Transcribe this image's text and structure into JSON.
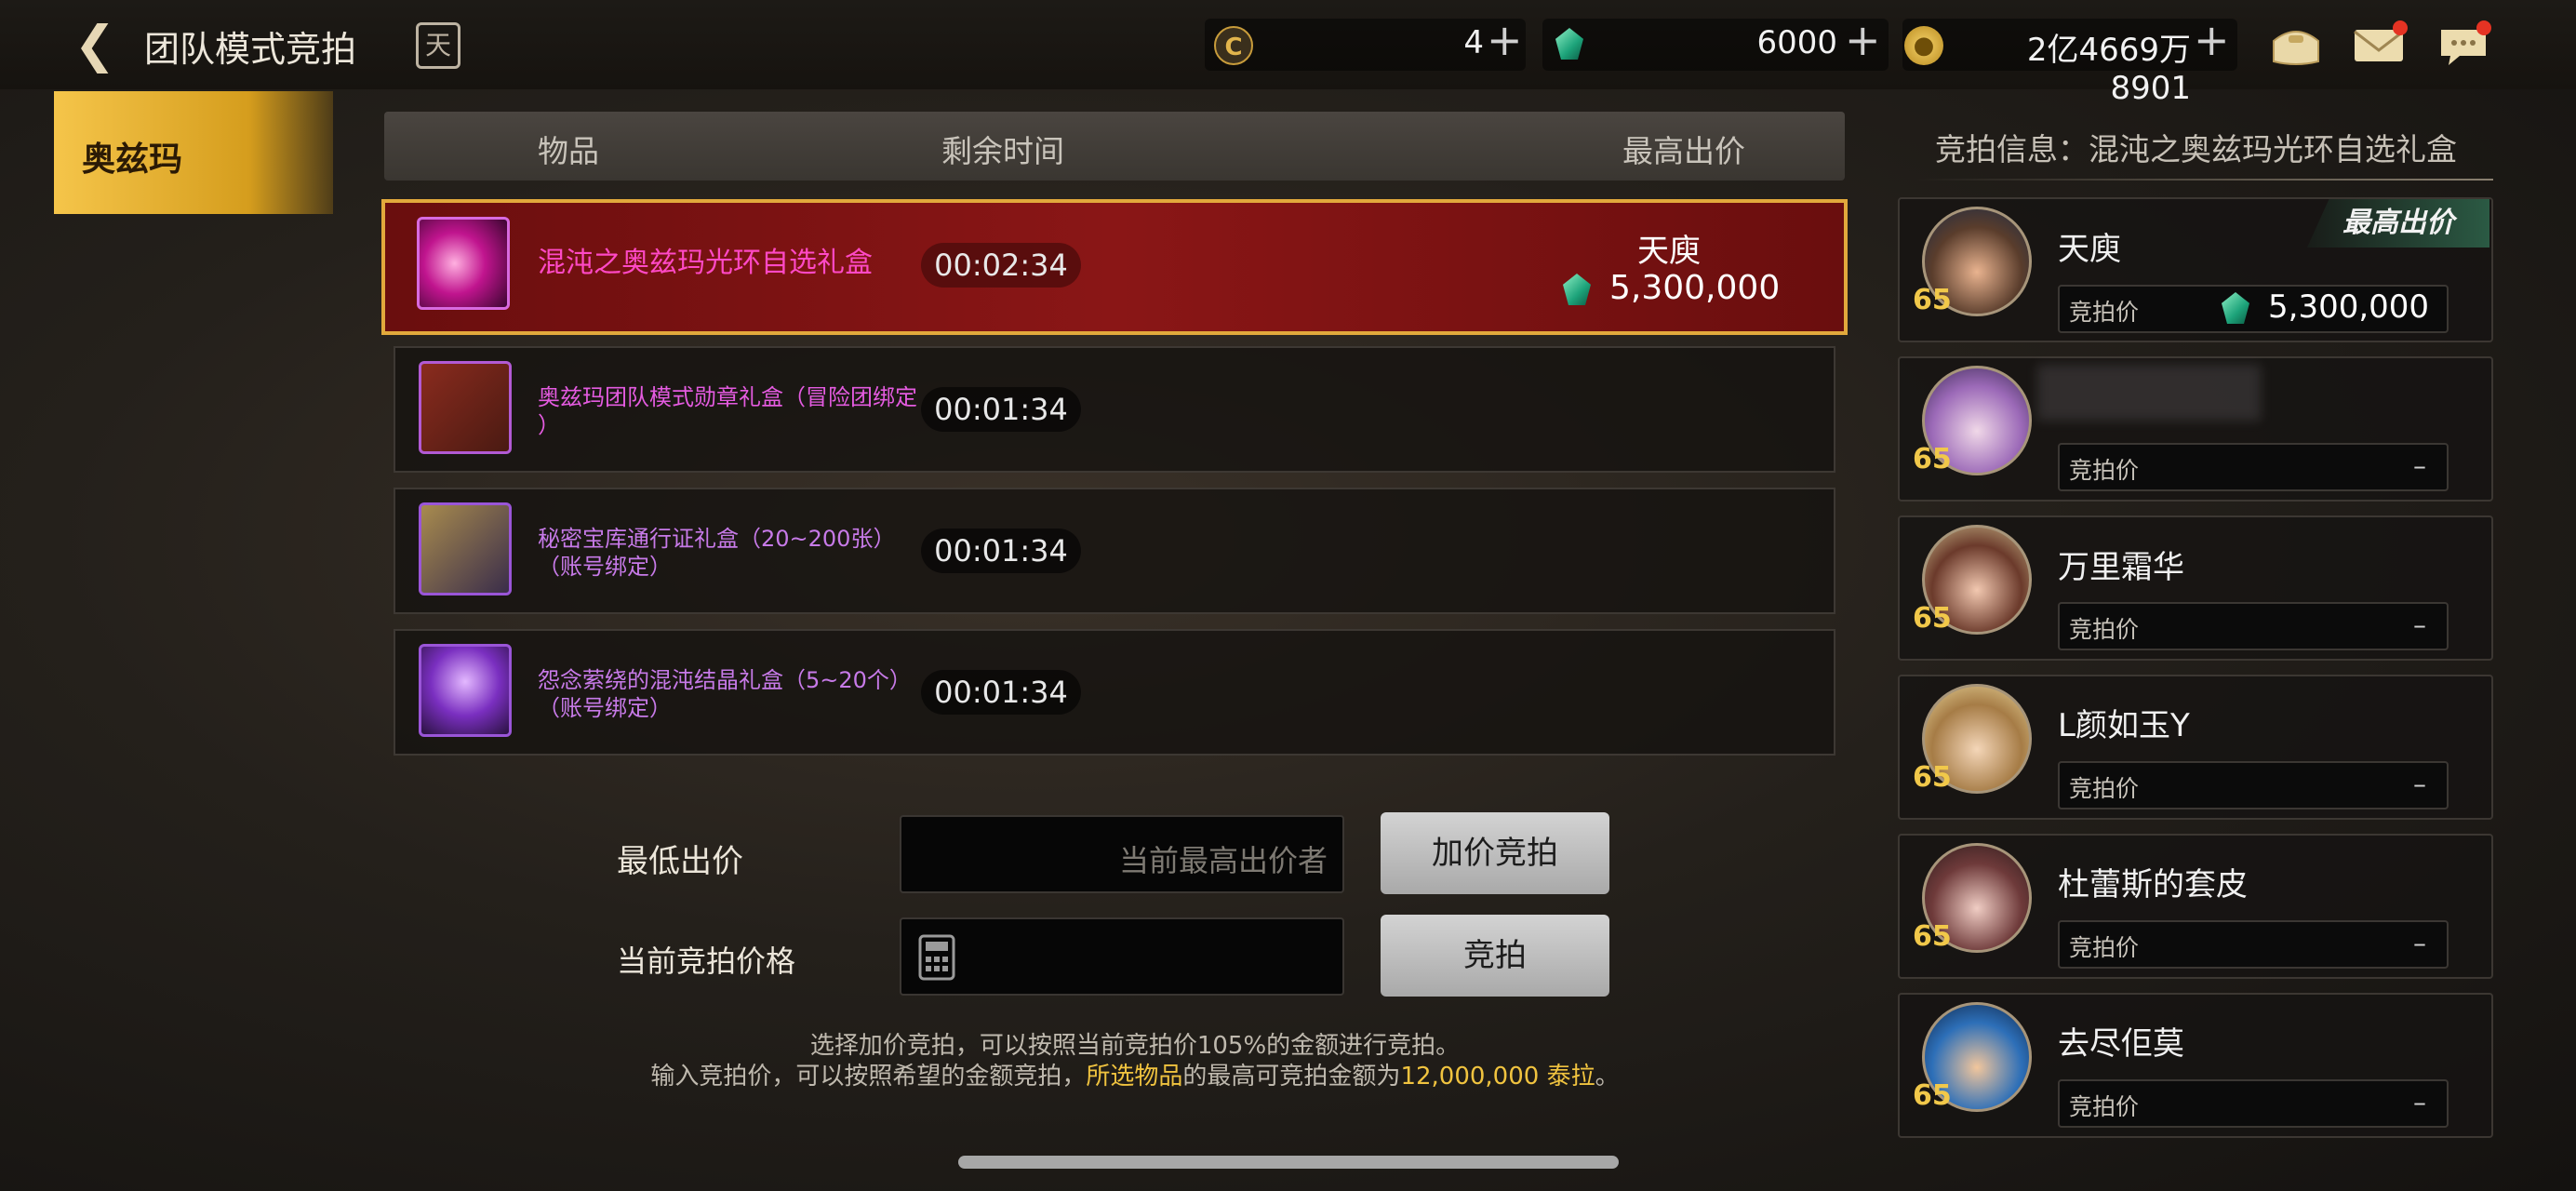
{
  "header": {
    "title": "团队模式竞拍",
    "calendar_icon_text": "天",
    "currencies": [
      {
        "icon": "coin-c-icon",
        "value": "4"
      },
      {
        "icon": "gem-icon",
        "value": "6000"
      },
      {
        "icon": "gold-icon",
        "value": "2亿4669万8901"
      }
    ],
    "plus": "+"
  },
  "left_tab": {
    "label": "奥兹玛"
  },
  "table": {
    "headers": {
      "item": "物品",
      "time": "剩余时间",
      "price": "最高出价"
    },
    "rows": [
      {
        "name": "混沌之奥兹玛光环自选礼盒",
        "time": "00:02:34",
        "bidder": "天庾",
        "price": "5,300,000"
      },
      {
        "name_line1": "奥兹玛团队模式勋章礼盒（冒险团绑定",
        "name_line2": "）",
        "time": "00:01:34"
      },
      {
        "name_line1": "秘密宝库通行证礼盒（20~200张）",
        "name_line2": "（账号绑定）",
        "time": "00:01:34"
      },
      {
        "name_line1": "怨念萦绕的混沌结晶礼盒（5~20个）",
        "name_line2": "（账号绑定）",
        "time": "00:01:34"
      }
    ]
  },
  "form": {
    "min_bid_label": "最低出价",
    "min_bid_placeholder": "当前最高出价者",
    "raise_button": "加价竞拍",
    "current_price_label": "当前竞拍价格",
    "bid_button": "竞拍",
    "hint_line1": "选择加价竞拍，可以按照当前竞拍价105%的金额进行竞拍。",
    "hint_line2_a": "输入竞拍价，可以按照希望的金额竞拍，",
    "hint_line2_b": "所选物品",
    "hint_line2_c": "的最高可竞拍金额为",
    "hint_line2_d": "12,000,000 泰拉",
    "hint_line2_e": "。"
  },
  "panel": {
    "title": "竞拍信息：混沌之奥兹玛光环自选礼盒",
    "top_badge": "最高出价",
    "bid_label": "竞拍价",
    "bidders": [
      {
        "name": "天庾",
        "level": "65",
        "bid": "5,300,000",
        "has_bid": true
      },
      {
        "name": "",
        "level": "65",
        "bid": "–",
        "has_bid": false
      },
      {
        "name": "万里霜华",
        "level": "65",
        "bid": "–",
        "has_bid": false
      },
      {
        "name": "L颜如玉Y",
        "level": "65",
        "bid": "–",
        "has_bid": false
      },
      {
        "name": "杜蕾斯的套皮",
        "level": "65",
        "bid": "–",
        "has_bid": false
      },
      {
        "name": "去尽佢莫",
        "level": "65",
        "bid": "–",
        "has_bid": false
      }
    ]
  },
  "colors": {
    "accent_gold": "#f0c33f",
    "selected_row": "#8a1616",
    "item_name_pink": "#ff49c6",
    "item_name_purple": "#c77ae8"
  }
}
